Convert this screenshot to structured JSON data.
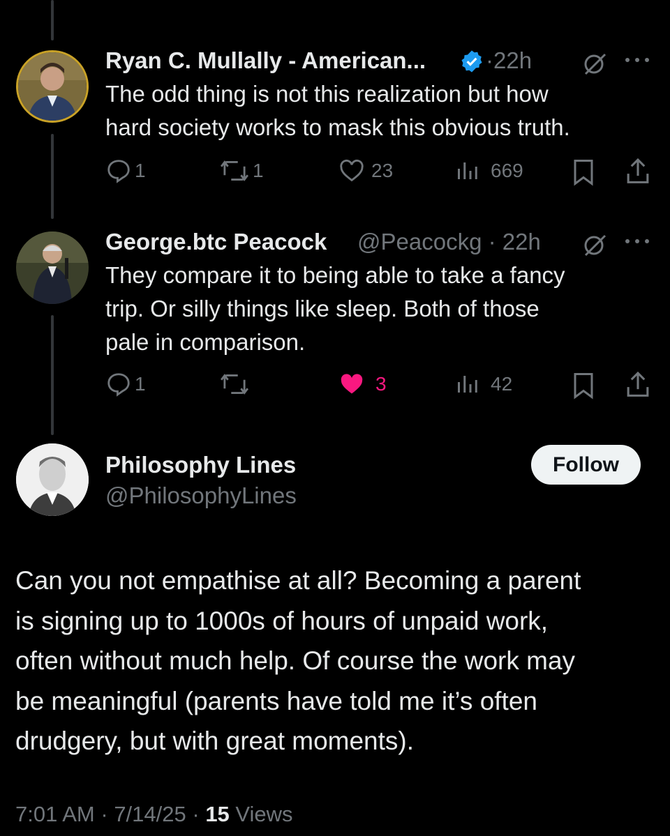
{
  "replies": [
    {
      "name": "Ryan C. Mullally - American...",
      "verified": true,
      "time": "22h",
      "text_lines": [
        "The odd thing is not this realization but how",
        "hard society works to mask this obvious truth."
      ],
      "stats": {
        "replies": "1",
        "reposts": "1",
        "likes": "23",
        "views": "669"
      }
    },
    {
      "name": "George.btc Peacock",
      "handle": "@Peacockg",
      "time": "22h",
      "text_lines": [
        "They compare it to being able to take a fancy",
        "trip. Or silly things like sleep. Both of those",
        "pale in comparison."
      ],
      "stats": {
        "replies": "1",
        "likes": "3",
        "views": "42"
      }
    }
  ],
  "main_post": {
    "name": "Philosophy Lines",
    "handle": "@PhilosophyLines",
    "follow_label": "Follow",
    "text_lines": [
      "Can you not empathise at all? Becoming a parent",
      "is signing up to 1000s of hours of unpaid work,",
      "often without much help. Of course the work may",
      "be meaningful (parents have told me it’s often",
      "drudgery, but with great moments)."
    ],
    "time": "7:01 AM",
    "date": "7/14/25",
    "views_count": "15",
    "views_label": "Views"
  },
  "colors": {
    "bg": "#000000",
    "text": "#e7e9ea",
    "muted": "#71767b",
    "verified": "#1d9bf0",
    "like_active": "#f91880",
    "avatar_ring": "#c9a227"
  }
}
